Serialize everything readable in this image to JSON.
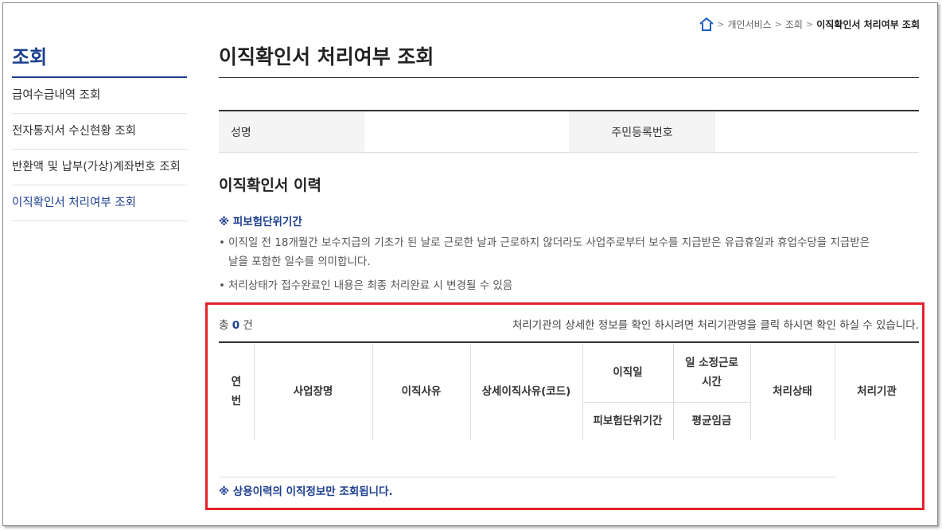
{
  "breadcrumb": {
    "items": [
      "개인서비스",
      "조회"
    ],
    "current": "이직확인서 처리여부 조회"
  },
  "sidebar": {
    "title": "조회",
    "items": [
      {
        "label": "급여수급내역 조회"
      },
      {
        "label": "전자통지서 수신현황 조회"
      },
      {
        "label": "반환액 및 납부(가상)계좌번호 조회"
      },
      {
        "label": "이직확인서 처리여부 조회"
      }
    ]
  },
  "main": {
    "title": "이직확인서 처리여부 조회",
    "info": {
      "name_label": "성명",
      "name_value": "",
      "rrn_label": "주민등록번호",
      "rrn_value": ""
    },
    "section_title": "이직확인서 이력",
    "note_head": "※ 피보험단위기간",
    "bullet1_line1": "이직일 전 18개월간 보수지급의 기초가 된 날로 근로한 날과 근로하지 않더라도 사업주로부터 보수를 지급받은 유급휴일과 휴업수당을 지급받은",
    "bullet1_line2": "날을 포함한 일수를 의미합니다.",
    "bullet2": "처리상태가 접수완료인 내용은 최종 처리완료 시 변경될 수 있음",
    "result": {
      "count_prefix": "총",
      "count": "0",
      "count_suffix": "건",
      "hint": "처리기관의 상세한 정보를 확인 하시려면 처리기관명을 클릭 하시면 확인 하실 수 있습니다."
    },
    "table": {
      "headers": {
        "no": "연\n번",
        "company": "사업장명",
        "reason": "이직사유",
        "detail_reason": "상세이직사유(코드)",
        "leave_date": "이직일",
        "insured_period": "피보험단위기간",
        "work_hours": "일 소정근로\n시간",
        "avg_wage": "평균임금",
        "status": "처리상태",
        "agency": "처리기관"
      },
      "rows": []
    },
    "footer_note": "※ 상용이력의 이직정보만 조회됩니다."
  },
  "colors": {
    "accent": "#1d3f8f",
    "highlight": "#e3212b",
    "header_bg": "#f4f4f4"
  },
  "icons": {
    "home": "home-icon",
    "separator": "chevron-right-icon"
  }
}
